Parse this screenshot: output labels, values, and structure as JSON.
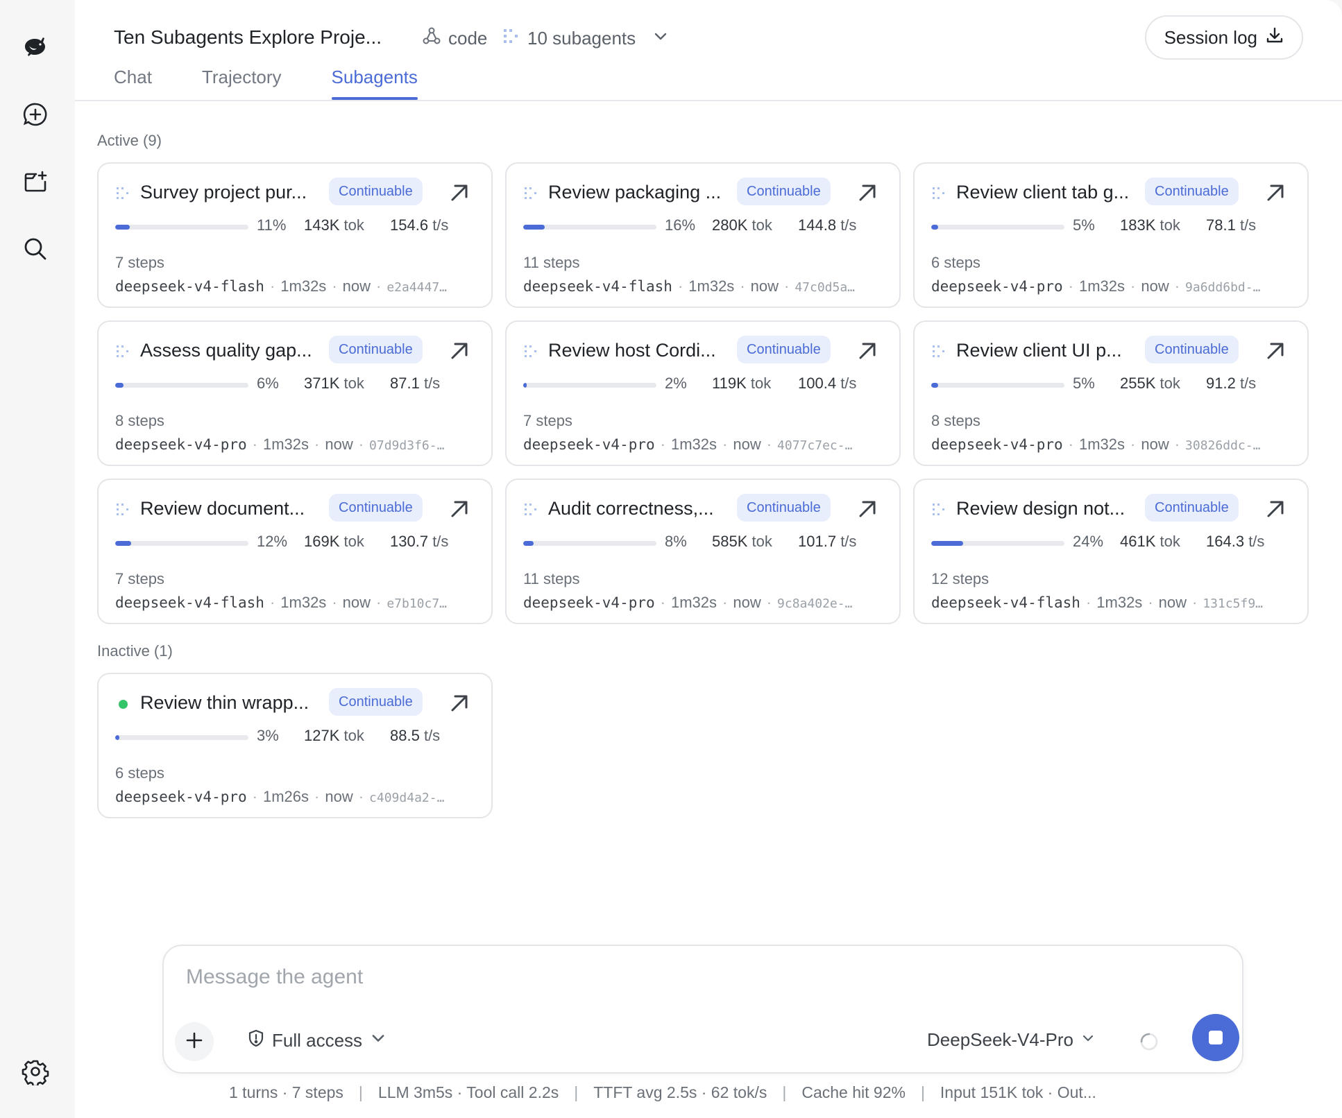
{
  "header": {
    "title": "Ten Subagents Explore Proje...",
    "mode_label": "code",
    "subagents_label": "10 subagents",
    "session_log_label": "Session log"
  },
  "tabs": [
    {
      "label": "Chat",
      "active": false
    },
    {
      "label": "Trajectory",
      "active": false
    },
    {
      "label": "Subagents",
      "active": true
    }
  ],
  "sections": {
    "active_label": "Active (9)",
    "inactive_label": "Inactive (1)"
  },
  "cards": [
    {
      "title": "Survey project pur...",
      "badge": "Continuable",
      "progress": 0.11,
      "pct": "11%",
      "tok_value": "143K",
      "tok_unit": "tok",
      "tps_value": "154.6",
      "tps_unit": "t/s",
      "steps": "7 steps",
      "model": "deepseek-v4-flash",
      "duration": "1m32s",
      "when": "now",
      "hash": "e2a4447…",
      "state": "active"
    },
    {
      "title": "Review packaging ...",
      "badge": "Continuable",
      "progress": 0.16,
      "pct": "16%",
      "tok_value": "280K",
      "tok_unit": "tok",
      "tps_value": "144.8",
      "tps_unit": "t/s",
      "steps": "11 steps",
      "model": "deepseek-v4-flash",
      "duration": "1m32s",
      "when": "now",
      "hash": "47c0d5a…",
      "state": "active"
    },
    {
      "title": "Review client tab g...",
      "badge": "Continuable",
      "progress": 0.05,
      "pct": "5%",
      "tok_value": "183K",
      "tok_unit": "tok",
      "tps_value": "78.1",
      "tps_unit": "t/s",
      "steps": "6 steps",
      "model": "deepseek-v4-pro",
      "duration": "1m32s",
      "when": "now",
      "hash": "9a6dd6bd-…",
      "state": "active"
    },
    {
      "title": "Assess quality gap...",
      "badge": "Continuable",
      "progress": 0.06,
      "pct": "6%",
      "tok_value": "371K",
      "tok_unit": "tok",
      "tps_value": "87.1",
      "tps_unit": "t/s",
      "steps": "8 steps",
      "model": "deepseek-v4-pro",
      "duration": "1m32s",
      "when": "now",
      "hash": "07d9d3f6-…",
      "state": "active"
    },
    {
      "title": "Review host Cordi...",
      "badge": "Continuable",
      "progress": 0.02,
      "pct": "2%",
      "tok_value": "119K",
      "tok_unit": "tok",
      "tps_value": "100.4",
      "tps_unit": "t/s",
      "steps": "7 steps",
      "model": "deepseek-v4-pro",
      "duration": "1m32s",
      "when": "now",
      "hash": "4077c7ec-…",
      "state": "active"
    },
    {
      "title": "Review client UI p...",
      "badge": "Continuable",
      "progress": 0.05,
      "pct": "5%",
      "tok_value": "255K",
      "tok_unit": "tok",
      "tps_value": "91.2",
      "tps_unit": "t/s",
      "steps": "8 steps",
      "model": "deepseek-v4-pro",
      "duration": "1m32s",
      "when": "now",
      "hash": "30826ddc-…",
      "state": "active"
    },
    {
      "title": "Review document...",
      "badge": "Continuable",
      "progress": 0.12,
      "pct": "12%",
      "tok_value": "169K",
      "tok_unit": "tok",
      "tps_value": "130.7",
      "tps_unit": "t/s",
      "steps": "7 steps",
      "model": "deepseek-v4-flash",
      "duration": "1m32s",
      "when": "now",
      "hash": "e7b10c7…",
      "state": "active"
    },
    {
      "title": "Audit correctness,...",
      "badge": "Continuable",
      "progress": 0.08,
      "pct": "8%",
      "tok_value": "585K",
      "tok_unit": "tok",
      "tps_value": "101.7",
      "tps_unit": "t/s",
      "steps": "11 steps",
      "model": "deepseek-v4-pro",
      "duration": "1m32s",
      "when": "now",
      "hash": "9c8a402e-…",
      "state": "active"
    },
    {
      "title": "Review design not...",
      "badge": "Continuable",
      "progress": 0.24,
      "pct": "24%",
      "tok_value": "461K",
      "tok_unit": "tok",
      "tps_value": "164.3",
      "tps_unit": "t/s",
      "steps": "12 steps",
      "model": "deepseek-v4-flash",
      "duration": "1m32s",
      "when": "now",
      "hash": "131c5f9…",
      "state": "active"
    },
    {
      "title": "Review thin wrapp...",
      "badge": "Continuable",
      "progress": 0.03,
      "pct": "3%",
      "tok_value": "127K",
      "tok_unit": "tok",
      "tps_value": "88.5",
      "tps_unit": "t/s",
      "steps": "6 steps",
      "model": "deepseek-v4-pro",
      "duration": "1m26s",
      "when": "now",
      "hash": "c409d4a2-…",
      "state": "inactive"
    }
  ],
  "composer": {
    "placeholder": "Message the agent",
    "value": "",
    "access_label": "Full access",
    "model_label": "DeepSeek-V4-Pro"
  },
  "statusline": [
    "1 turns · 7 steps",
    "LLM 3m5s · Tool call 2.2s",
    "TTFT avg 2.5s · 62 tok/s",
    "Cache hit 92%",
    "Input 151K tok · Out..."
  ],
  "colors": {
    "accent": "#4b6bd6",
    "badge_bg": "#e9eefc",
    "inactive_dot": "#34c46a"
  },
  "icons": {
    "logo": "whale-logo-icon",
    "new_chat": "new-chat-icon",
    "new_folder": "new-folder-icon",
    "search": "search-icon",
    "settings": "gear-icon"
  }
}
